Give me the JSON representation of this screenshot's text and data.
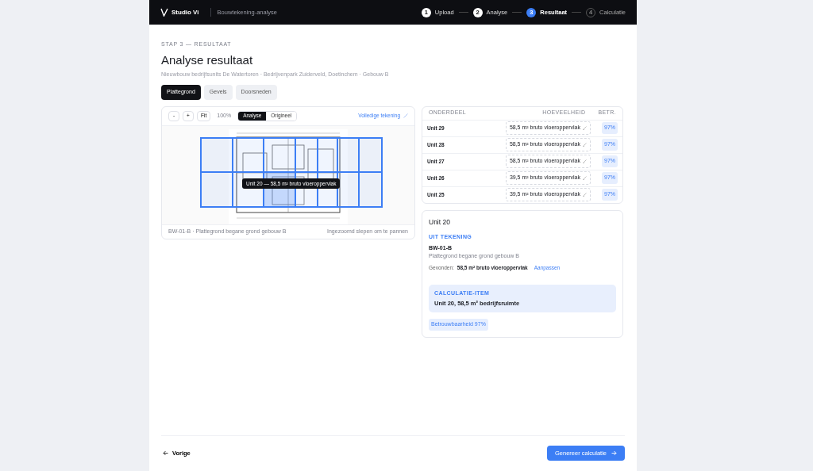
{
  "brand": {
    "name": "Studio Vi",
    "section": "Bouwtekening-analyse"
  },
  "steps": [
    {
      "number": "1",
      "label": "Upload",
      "completed": true,
      "selected": false
    },
    {
      "number": "2",
      "label": "Analyse",
      "completed": true,
      "selected": false
    },
    {
      "number": "3",
      "label": "Resultaat",
      "completed": false,
      "selected": true
    },
    {
      "number": "4",
      "label": "Calculatie",
      "completed": false,
      "selected": false
    }
  ],
  "page": {
    "eyebrow": "STAP 3 — RESULTAAT",
    "title": "Analyse resultaat",
    "subtitle": "Nieuwbouw bedrijfsunits De Watertoren · Bedrijvenpark Zuiderveld, Doetinchem · Gebouw B"
  },
  "tabs": [
    {
      "label": "Plattegrond",
      "selected": true
    },
    {
      "label": "Gevels",
      "selected": false
    },
    {
      "label": "Doorsneden",
      "selected": false
    }
  ],
  "viewer": {
    "zoom_out": "-",
    "zoom_in": "+",
    "fit": "Fit",
    "zoom_level": "100%",
    "modes": [
      {
        "label": "Analyse",
        "selected": true
      },
      {
        "label": "Origineel",
        "selected": false
      }
    ],
    "full_link": "Volledige tekening",
    "units": [
      {
        "selected": false
      },
      {
        "selected": false
      },
      {
        "selected": false
      },
      {
        "selected": false
      },
      {
        "selected": false
      },
      {
        "selected": false
      },
      {
        "selected": false
      },
      {
        "selected": false
      },
      {
        "selected": false
      },
      {
        "selected": true
      },
      {
        "selected": false
      },
      {
        "selected": false
      },
      {
        "selected": false
      },
      {
        "selected": false
      }
    ],
    "tooltip": "Unit 20 — 58,5 m² bruto vloeroppervlak",
    "caption": "BW-01-B · Plattegrond begane grond gebouw B",
    "hint": "Ingezoomd slepen om te pannen"
  },
  "table": {
    "columns": [
      "ONDERDEEL",
      "HOEVEELHEID",
      "BETR."
    ],
    "rows": [
      {
        "name": "Unit 29",
        "quantity": "58,5 m² bruto vloeroppervlak",
        "confidence": "97%"
      },
      {
        "name": "Unit 28",
        "quantity": "58,5 m² bruto vloeroppervlak",
        "confidence": "97%"
      },
      {
        "name": "Unit 27",
        "quantity": "58,5 m² bruto vloeroppervlak",
        "confidence": "97%"
      },
      {
        "name": "Unit 26",
        "quantity": "39,5 m² bruto vloeroppervlak",
        "confidence": "97%"
      },
      {
        "name": "Unit 25",
        "quantity": "39,5 m² bruto vloeroppervlak",
        "confidence": "97%"
      }
    ]
  },
  "detail": {
    "title": "Unit 20",
    "source_label": "UIT TEKENING",
    "drawing_code": "BW-01-B",
    "drawing_name": "Plattegrond begane grond gebouw B",
    "found_label": "Gevonden:",
    "found_value": "58,5 m² bruto vloeroppervlak",
    "adjust_link": "Aanpassen",
    "calc_label": "CALCULATIE-ITEM",
    "calc_value": "Unit 20, 58,5 m² bedrijfsruimte",
    "badge": "Betrouwbaarheid 97%"
  },
  "footer": {
    "back": "Vorige",
    "next": "Genereer calculatie"
  }
}
